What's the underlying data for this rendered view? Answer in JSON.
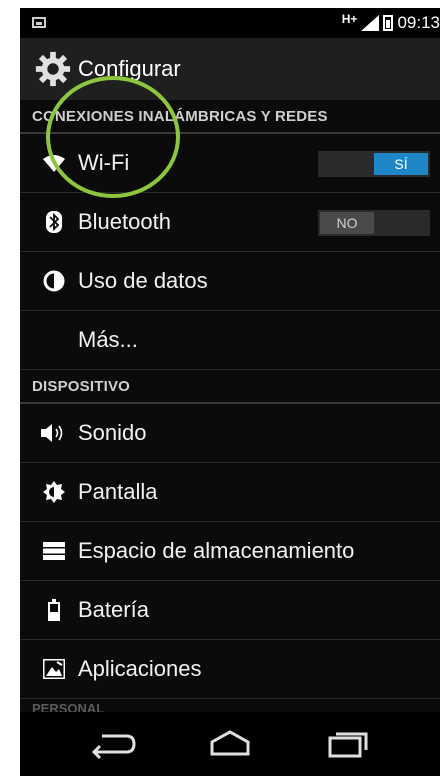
{
  "status_bar": {
    "network": "H+",
    "time": "09:13"
  },
  "action_bar": {
    "title": "Configurar",
    "icon": "gear-icon"
  },
  "sections": [
    {
      "header": "CONEXIONES INALÁMBRICAS Y REDES"
    },
    {
      "header": "DISPOSITIVO"
    },
    {
      "header": "PERSONAL"
    }
  ],
  "items": {
    "wifi": {
      "label": "Wi-Fi",
      "toggle": "SÍ",
      "icon": "wifi-icon"
    },
    "bluetooth": {
      "label": "Bluetooth",
      "toggle": "NO",
      "icon": "bluetooth-icon"
    },
    "data_usage": {
      "label": "Uso de datos",
      "icon": "data-usage-icon"
    },
    "more": {
      "label": "Más..."
    },
    "sound": {
      "label": "Sonido",
      "icon": "speaker-icon"
    },
    "display": {
      "label": "Pantalla",
      "icon": "brightness-icon"
    },
    "storage": {
      "label": "Espacio de almacenamiento",
      "icon": "storage-icon"
    },
    "battery": {
      "label": "Batería",
      "icon": "battery-icon"
    },
    "apps": {
      "label": "Aplicaciones",
      "icon": "apps-icon"
    }
  },
  "colors": {
    "toggle_on": "#1f87c8",
    "highlight": "#8cc63f"
  }
}
